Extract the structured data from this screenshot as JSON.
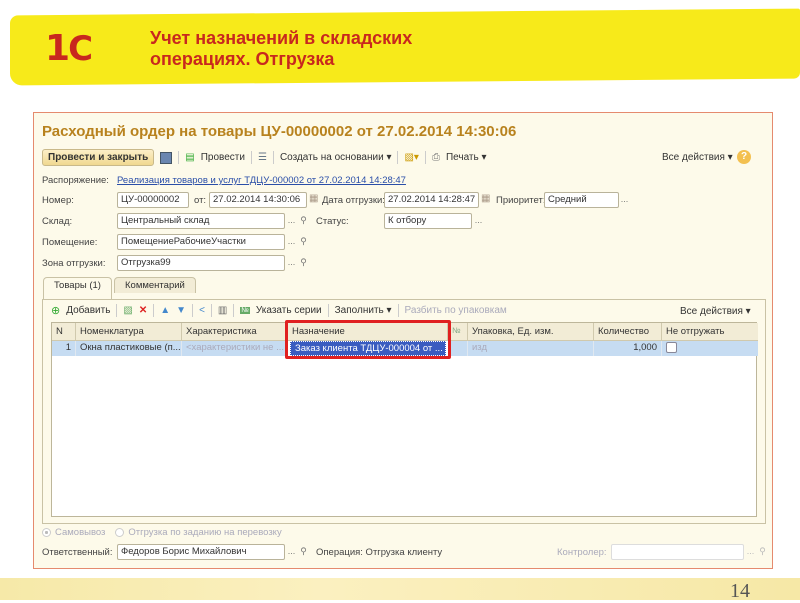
{
  "slide": {
    "logo": "1С",
    "title": "Учет назначений в складских операциях. Отгрузка",
    "page_number": "14"
  },
  "window": {
    "title": "Расходный ордер на товары ЦУ-00000002 от 27.02.2014 14:30:06"
  },
  "toolbar": {
    "post_close": "Провести и закрыть",
    "post": "Провести",
    "create_based": "Создать на основании ▾",
    "print": "Печать ▾",
    "all_actions": "Все действия ▾",
    "help": "?"
  },
  "form": {
    "order_label": "Распоряжение:",
    "order_link": "Реализация товаров и услуг ТДЦУ-000002 от 27.02.2014 14:28:47",
    "number_label": "Номер:",
    "number": "ЦУ-00000002",
    "from_label": "от:",
    "from": "27.02.2014 14:30:06",
    "ship_date_label": "Дата отгрузки:",
    "ship_date": "27.02.2014 14:28:47",
    "priority_label": "Приоритет:",
    "priority": "Средний",
    "warehouse_label": "Склад:",
    "warehouse": "Центральный склад",
    "status_label": "Статус:",
    "status": "К отбору",
    "room_label": "Помещение:",
    "room": "ПомещениеРабочиеУчастки",
    "zone_label": "Зона отгрузки:",
    "zone": "Отгрузка99"
  },
  "tabs": [
    {
      "label": "Товары (1)",
      "active": true
    },
    {
      "label": "Комментарий",
      "active": false
    }
  ],
  "table_toolbar": {
    "add": "Добавить",
    "series": "Указать серии",
    "fill": "Заполнить ▾",
    "split": "Разбить по упаковкам",
    "all_actions": "Все действия ▾"
  },
  "table": {
    "headers": [
      "N",
      "Номенклатура",
      "Характеристика",
      "Назначение",
      "№",
      "Упаковка, Ед. изм.",
      "Количество",
      "Не отгружать"
    ],
    "rows": [
      {
        "n": "1",
        "item": "Окна пластиковые (п...",
        "char": "<характеристики не ...",
        "purpose": "Заказ клиента ТДЦУ-000004 от ...",
        "pack": "изд",
        "qty": "1,000",
        "no_ship": false
      }
    ]
  },
  "footer": {
    "radio1": "Самовывоз",
    "radio2": "Отгрузка по заданию на перевозку",
    "responsible_label": "Ответственный:",
    "responsible": "Федоров Борис Михайлович",
    "operation": "Операция: Отгрузка клиенту",
    "controller_label": "Контролер:",
    "controller": ""
  },
  "colors": {
    "highlight": "#e02020",
    "accent": "#c8281e",
    "selection": "#3a5cc0"
  }
}
